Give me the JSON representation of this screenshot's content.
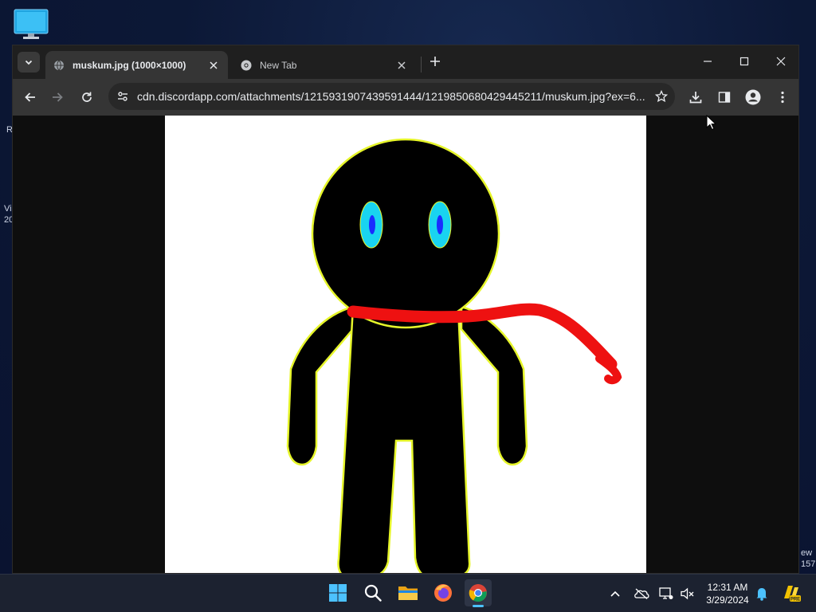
{
  "desktop": {
    "fragments": [
      "R",
      "Vi",
      "20",
      "ew",
      "157"
    ]
  },
  "browser": {
    "tabs": [
      {
        "title": "muskum.jpg (1000×1000)",
        "active": true
      },
      {
        "title": "New Tab",
        "active": false
      }
    ],
    "address": {
      "url": "cdn.discordapp.com/attachments/1215931907439591444/1219850680429445211/muskum.jpg?ex=6..."
    },
    "image": {
      "description": "stick-figure drawing",
      "colors": {
        "body": "#000000",
        "outline": "#e6f52a",
        "eyes": "#19d4f0",
        "pupils": "#1a2cff",
        "scarf": "#ee1111"
      }
    }
  },
  "taskbar": {
    "clock": {
      "time": "12:31 AM",
      "date": "3/29/2024"
    },
    "apps": [
      "start-icon",
      "search-icon",
      "file-explorer-icon",
      "firefox-icon",
      "chrome-icon"
    ]
  },
  "colors": {
    "tabbar": "#1f1f1f",
    "toolbar": "#353535",
    "omnibox": "#282828",
    "taskbar": "#1c2230",
    "accent": "#4cc2ff"
  }
}
